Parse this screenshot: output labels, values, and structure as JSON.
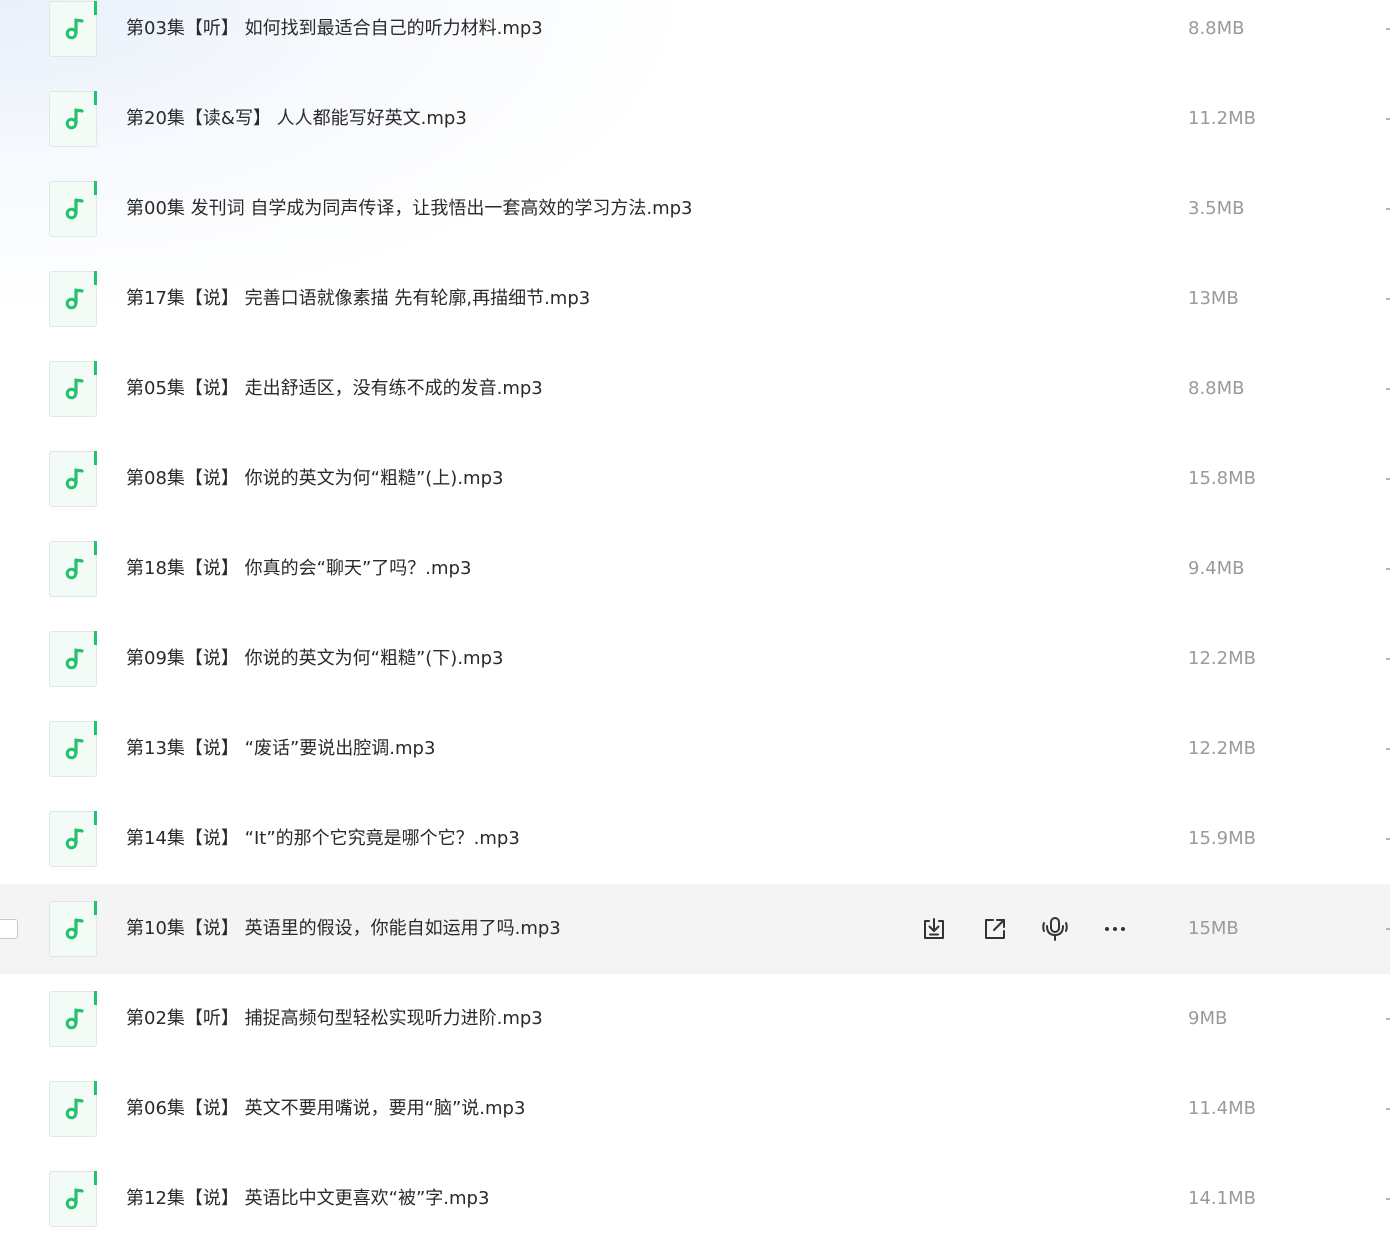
{
  "files": [
    {
      "name": "第03集【听】 如何找到最适合自己的听力材料.mp3",
      "size": "8.8MB"
    },
    {
      "name": "第20集【读&写】 人人都能写好英文.mp3",
      "size": "11.2MB"
    },
    {
      "name": "第00集 发刊词 自学成为同声传译，让我悟出一套高效的学习方法.mp3",
      "size": "3.5MB"
    },
    {
      "name": "第17集【说】 完善口语就像素描 先有轮廓,再描细节.mp3",
      "size": "13MB"
    },
    {
      "name": "第05集【说】 走出舒适区，没有练不成的发音.mp3",
      "size": "8.8MB"
    },
    {
      "name": "第08集【说】 你说的英文为何“粗糙”(上).mp3",
      "size": "15.8MB"
    },
    {
      "name": "第18集【说】 你真的会“聊天”了吗？.mp3",
      "size": "9.4MB"
    },
    {
      "name": "第09集【说】 你说的英文为何“粗糙”(下).mp3",
      "size": "12.2MB"
    },
    {
      "name": "第13集【说】 “废话”要说出腔调.mp3",
      "size": "12.2MB"
    },
    {
      "name": "第14集【说】 “It”的那个它究竟是哪个它？.mp3",
      "size": "15.9MB"
    },
    {
      "name": "第10集【说】 英语里的假设，你能自如运用了吗.mp3",
      "size": "15MB",
      "hovered": true
    },
    {
      "name": "第02集【听】 捕捉高频句型轻松实现听力进阶.mp3",
      "size": "9MB"
    },
    {
      "name": "第06集【说】 英文不要用嘴说，要用“脑”说.mp3",
      "size": "11.4MB"
    },
    {
      "name": "第12集【说】 英语比中文更喜欢“被”字.mp3",
      "size": "14.1MB"
    }
  ],
  "row_actions": [
    "download-icon",
    "share-icon",
    "voice-icon",
    "more-icon"
  ],
  "colors": {
    "accent": "#25c26e",
    "text": "#2a2a2a",
    "muted": "#9a9a9a",
    "hover_bg": "#f4f4f4",
    "icon_bg": "#f3fbf6"
  }
}
